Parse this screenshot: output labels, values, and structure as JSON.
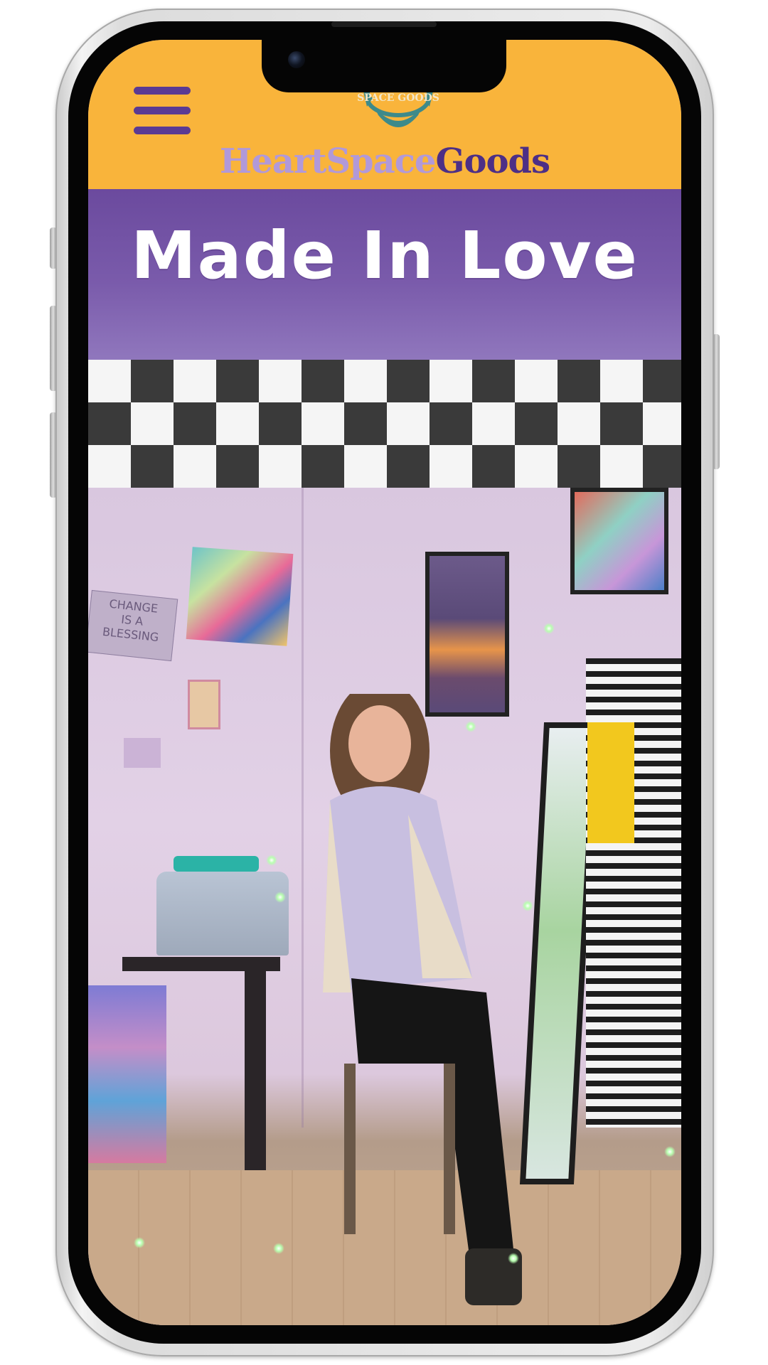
{
  "site": {
    "brand": {
      "part1": "Heart",
      "part2": "Space",
      "part3": "Goods",
      "emblem_text": "SPACE GOODS"
    },
    "hero_title": "Made In Love",
    "photo": {
      "wall_sign_line1": "CHANGE",
      "wall_sign_line2": "IS A",
      "wall_sign_line3": "BLESSING"
    }
  },
  "colors": {
    "header_bg": "#f9b43b",
    "brand_purple_light": "#b199d9",
    "brand_purple_dark": "#4d2f86",
    "title_band": "#7a5bab",
    "checker_dark": "#3a3a3a",
    "checker_light": "#f5f5f5"
  },
  "icons": {
    "menu": "hamburger-menu-icon",
    "emblem": "mandala-logo-icon"
  }
}
